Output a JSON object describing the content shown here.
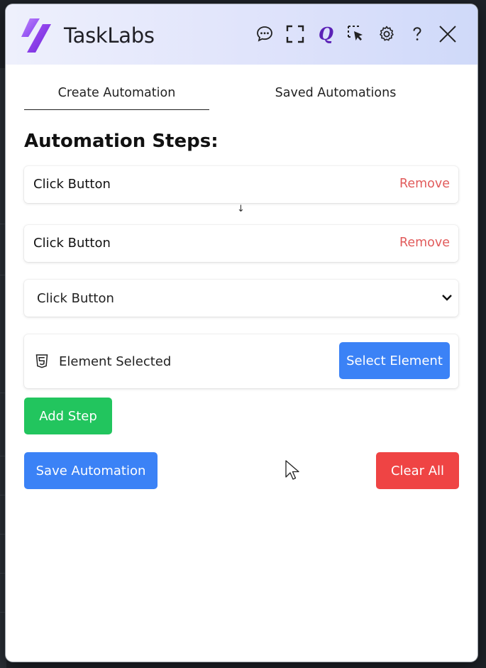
{
  "header": {
    "brand": "TaskLabs",
    "icons": [
      "chat-bubble-icon",
      "fullscreen-icon",
      "q-logo-icon",
      "select-cursor-icon",
      "gear-icon",
      "help-icon",
      "close-icon"
    ],
    "accent": "#7c3aed"
  },
  "tabs": [
    {
      "label": "Create Automation",
      "active": true
    },
    {
      "label": "Saved Automations",
      "active": false
    }
  ],
  "main": {
    "section_title": "Automation Steps:",
    "steps": [
      {
        "label": "Click Button",
        "remove_label": "Remove"
      },
      {
        "label": "Click Button",
        "remove_label": "Remove"
      }
    ],
    "step_arrow": "↓",
    "action_select": {
      "value": "Click Button"
    },
    "element": {
      "status": "Element Selected",
      "button_label": "Select Element"
    },
    "add_step_label": "Add Step",
    "save_label": "Save Automation",
    "clear_label": "Clear All"
  },
  "colors": {
    "blue": "#3b82f6",
    "green": "#22c55e",
    "red": "#ef4444",
    "remove_text": "#e15b5b"
  }
}
